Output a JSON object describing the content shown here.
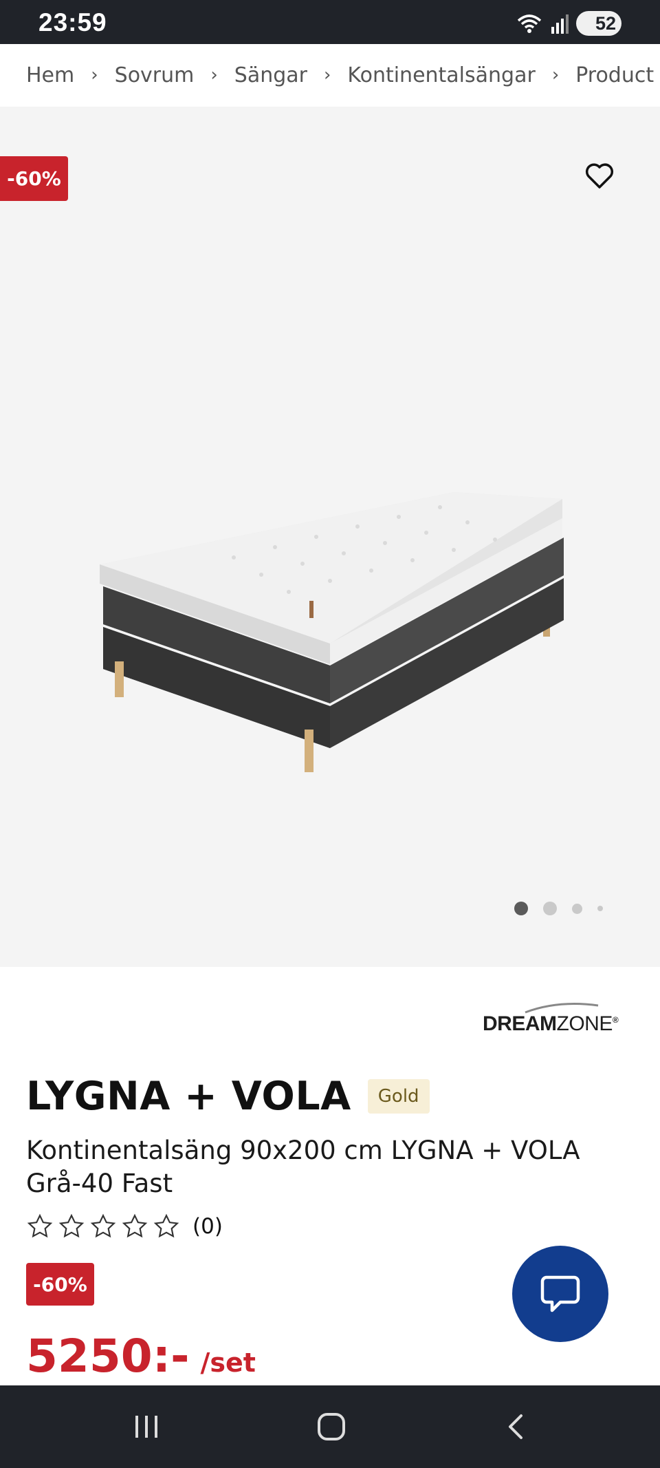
{
  "status_bar": {
    "time": "23:59",
    "battery": "52",
    "icons": [
      "wifi-icon",
      "signal-icon",
      "battery-icon"
    ]
  },
  "breadcrumb": [
    "Hem",
    "Sovrum",
    "Sängar",
    "Kontinentalsängar",
    "Product"
  ],
  "gallery": {
    "discount_badge": "-60%",
    "slides": 4,
    "active_slide": 1
  },
  "brand": {
    "name_bold": "DREAM",
    "name_light": "ZONE",
    "mark": "®"
  },
  "product": {
    "title": "LYGNA + VOLA",
    "tier": "Gold",
    "subtitle": "Kontinentalsäng 90x200 cm LYGNA + VOLA Grå-40 Fast",
    "rating_stars": 0,
    "review_count": "(0)",
    "discount_badge": "-60%",
    "price": "5250:-",
    "unit": "/set"
  },
  "colors": {
    "sale_red": "#c8232c",
    "chat_blue": "#123d8e",
    "gold_bg": "#f7efd7",
    "status_bar": "#202329"
  }
}
